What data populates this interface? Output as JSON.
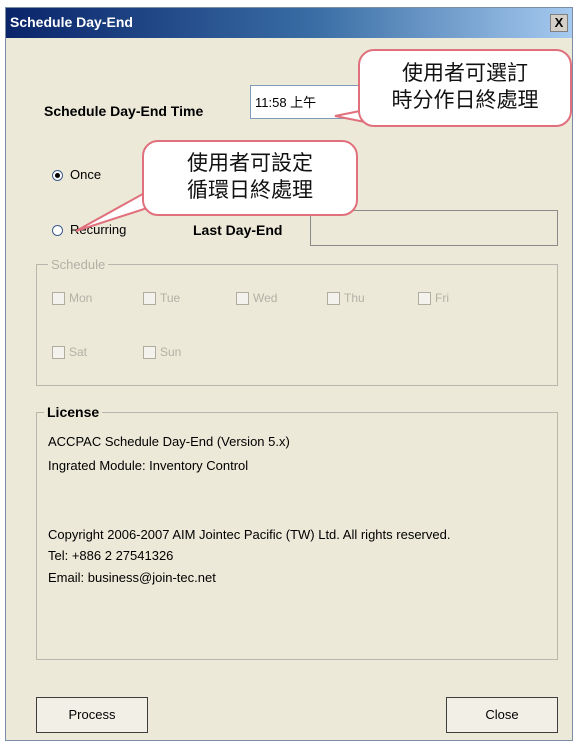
{
  "window": {
    "title": "Schedule Day-End",
    "close_label": "X"
  },
  "schedule_time": {
    "label": "Schedule Day-End Time",
    "value": "11:58 上午"
  },
  "options": {
    "once_label": "Once",
    "recurring_label": "Recurring",
    "selected": "once"
  },
  "last_day_end": {
    "label": "Last Day-End",
    "value": ""
  },
  "schedule_group": {
    "title": "Schedule",
    "days": [
      "Mon",
      "Tue",
      "Wed",
      "Thu",
      "Fri",
      "Sat",
      "Sun"
    ]
  },
  "license": {
    "title": "License",
    "line1": "ACCPAC Schedule Day-End (Version 5.x)",
    "line2": "Ingrated Module: Inventory Control",
    "copyright": "Copyright 2006-2007 AIM Jointec Pacific (TW) Ltd. All rights reserved.",
    "tel": "Tel: +886 2 27541326",
    "email": "Email: business@join-tec.net"
  },
  "buttons": {
    "process": "Process",
    "close": "Close"
  },
  "callouts": {
    "time": {
      "line1": "使用者可選訂",
      "line2": "時分作日終處理"
    },
    "recurring": {
      "line1": "使用者可設定",
      "line2": "循環日終處理"
    }
  },
  "colors": {
    "title_start": "#0a246a",
    "title_end": "#a6caf0",
    "window_bg": "#ece9d8",
    "callout_border": "#e0707c"
  }
}
